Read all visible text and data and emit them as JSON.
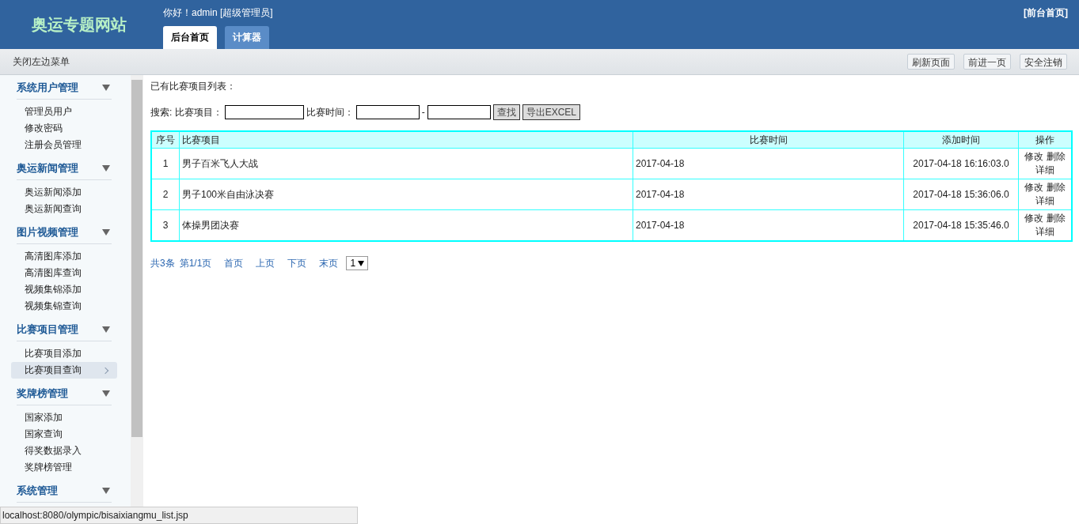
{
  "header": {
    "logo": "奥运专题网站",
    "greeting": "你好！admin [超级管理员]",
    "front_link": "[前台首页]",
    "tabs": [
      {
        "label": "后台首页",
        "selected": true
      },
      {
        "label": "计算器",
        "selected": false
      }
    ]
  },
  "toolbar": {
    "toggle_menu": "关闭左边菜单",
    "buttons": [
      "刷新页面",
      "前进一页",
      "安全注销"
    ]
  },
  "sidebar": {
    "groups": [
      {
        "title": "系统用户管理",
        "expanded": true,
        "items": [
          {
            "label": "管理员用户",
            "selected": false
          },
          {
            "label": "修改密码",
            "selected": false
          },
          {
            "label": "注册会员管理",
            "selected": false
          }
        ]
      },
      {
        "title": "奥运新闻管理",
        "expanded": true,
        "items": [
          {
            "label": "奥运新闻添加",
            "selected": false
          },
          {
            "label": "奥运新闻查询",
            "selected": false
          }
        ]
      },
      {
        "title": "图片视频管理",
        "expanded": true,
        "items": [
          {
            "label": "高清图库添加",
            "selected": false
          },
          {
            "label": "高清图库查询",
            "selected": false
          },
          {
            "label": "视频集锦添加",
            "selected": false
          },
          {
            "label": "视频集锦查询",
            "selected": false
          }
        ]
      },
      {
        "title": "比赛项目管理",
        "expanded": true,
        "items": [
          {
            "label": "比赛项目添加",
            "selected": false
          },
          {
            "label": "比赛项目查询",
            "selected": true
          }
        ]
      },
      {
        "title": "奖牌榜管理",
        "expanded": true,
        "items": [
          {
            "label": "国家添加",
            "selected": false
          },
          {
            "label": "国家查询",
            "selected": false
          },
          {
            "label": "得奖数据录入",
            "selected": false
          },
          {
            "label": "奖牌榜管理",
            "selected": false
          }
        ]
      },
      {
        "title": "系统管理",
        "expanded": true
      }
    ]
  },
  "main": {
    "heading": "已有比赛项目列表：",
    "search": {
      "label": "搜索: 比赛项目：",
      "time_label": "比赛时间：",
      "separator": "-",
      "find_button": "查找",
      "export_button": "导出EXCEL"
    },
    "table": {
      "columns": [
        "序号",
        "比赛项目",
        "比赛时间",
        "添加时间",
        "操作"
      ],
      "rows": [
        {
          "no": "1",
          "name": "男子百米飞人大战",
          "date": "2017-04-18",
          "added": "2017-04-18 16:16:03.0",
          "actions": [
            "修改",
            "删除",
            "详细"
          ]
        },
        {
          "no": "2",
          "name": "男子100米自由泳决赛",
          "date": "2017-04-18",
          "added": "2017-04-18 15:36:06.0",
          "actions": [
            "修改",
            "删除",
            "详细"
          ]
        },
        {
          "no": "3",
          "name": "体操男团决赛",
          "date": "2017-04-18",
          "added": "2017-04-18 15:35:46.0",
          "actions": [
            "修改",
            "删除",
            "详细"
          ]
        }
      ]
    },
    "pagination": {
      "total": "共3条",
      "page": "第1/1页",
      "links": [
        "首页",
        "上页",
        "下页",
        "末页"
      ],
      "page_select": "1"
    }
  },
  "status_bar": {
    "url": "localhost:8080/olympic/bisaixiangmu_list.jsp"
  }
}
